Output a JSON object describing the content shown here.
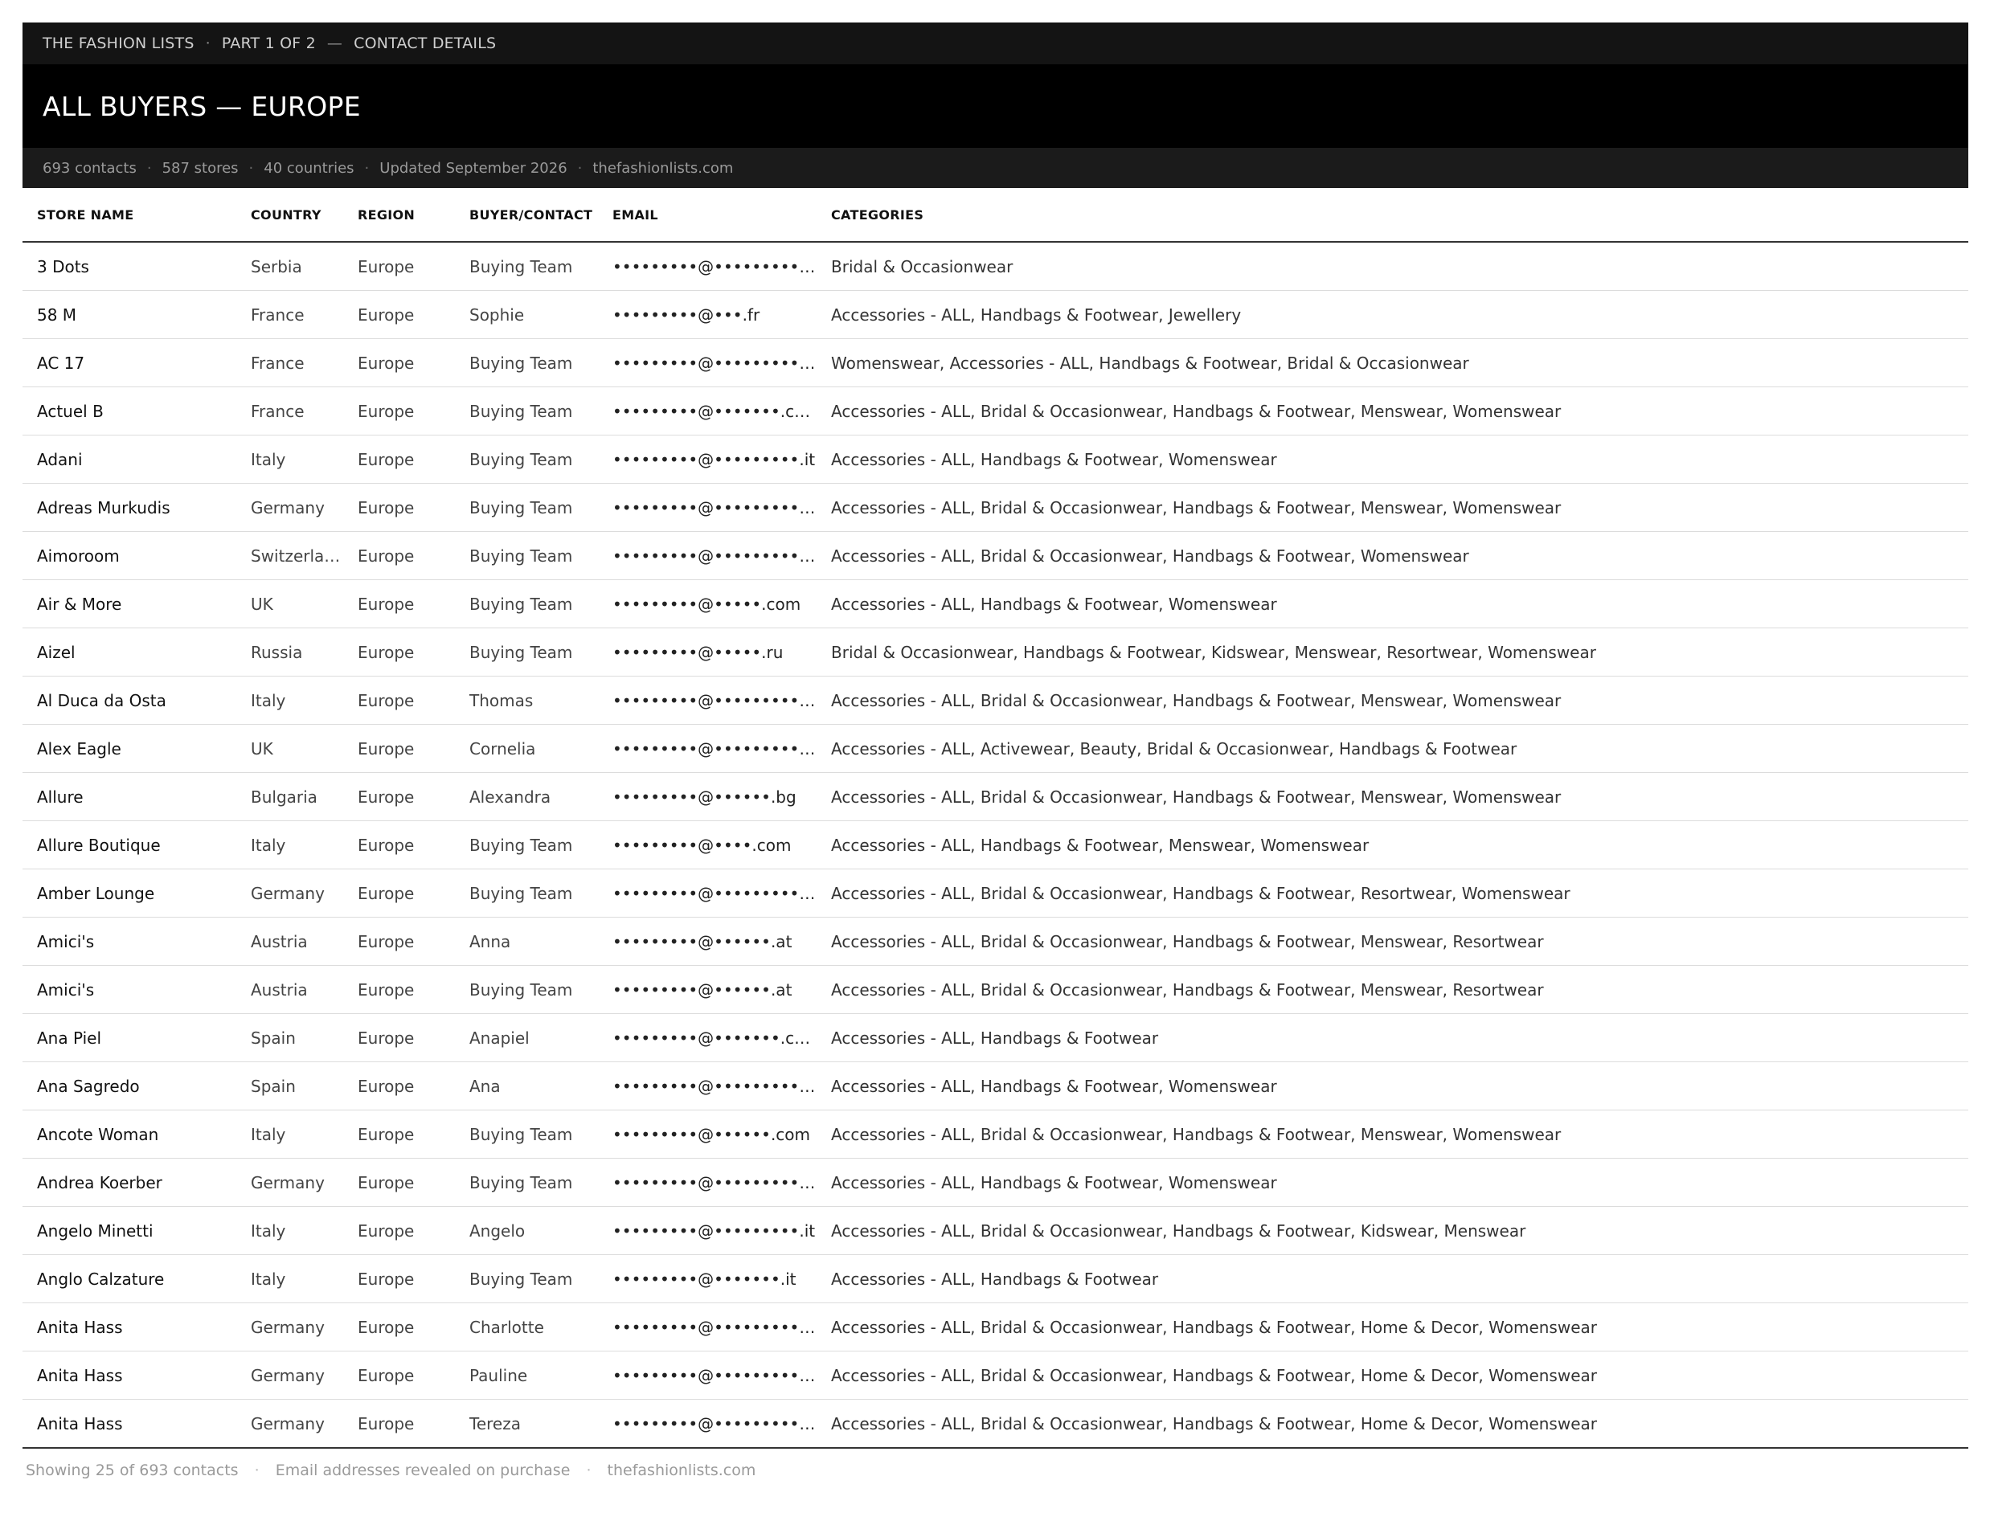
{
  "topbar": {
    "brand": "THE FASHION LISTS",
    "sep": "·",
    "part": "PART 1 OF 2",
    "dash": "—",
    "section": "CONTACT DETAILS"
  },
  "title": "ALL BUYERS — EUROPE",
  "meta": {
    "contacts": "693 contacts",
    "stores": "587 stores",
    "countries": "40 countries",
    "updated": "Updated September 2026",
    "site": "thefashionlists.com",
    "dot": "·"
  },
  "table": {
    "headers": [
      "STORE NAME",
      "COUNTRY",
      "REGION",
      "BUYER/CONTACT",
      "EMAIL",
      "CATEGORIES"
    ],
    "rows": [
      {
        "store": "3 Dots",
        "country": "Serbia",
        "region": "Europe",
        "buyer": "Buying Team",
        "email": "•••••••••@•••••••••.com",
        "categories": "Bridal & Occasionwear"
      },
      {
        "store": "58 M",
        "country": "France",
        "region": "Europe",
        "buyer": "Sophie",
        "email": "•••••••••@•••.fr",
        "categories": "Accessories - ALL, Handbags & Footwear, Jewellery"
      },
      {
        "store": "AC 17",
        "country": "France",
        "region": "Europe",
        "buyer": "Buying Team",
        "email": "•••••••••@•••••••••.com",
        "categories": "Womenswear, Accessories - ALL, Handbags & Footwear, Bridal & Occasionwear"
      },
      {
        "store": "Actuel B",
        "country": "France",
        "region": "Europe",
        "buyer": "Buying Team",
        "email": "•••••••••@•••••••.com",
        "categories": "Accessories - ALL, Bridal & Occasionwear, Handbags & Footwear, Menswear, Womenswear"
      },
      {
        "store": "Adani",
        "country": "Italy",
        "region": "Europe",
        "buyer": "Buying Team",
        "email": "•••••••••@•••••••••.it",
        "categories": "Accessories - ALL, Handbags & Footwear, Womenswear"
      },
      {
        "store": "Adreas Murkudis",
        "country": "Germany",
        "region": "Europe",
        "buyer": "Buying Team",
        "email": "•••••••••@•••••••••.com",
        "categories": "Accessories - ALL, Bridal & Occasionwear, Handbags & Footwear, Menswear, Womenswear"
      },
      {
        "store": "Aimoroom",
        "country": "Switzerland",
        "region": "Europe",
        "buyer": "Buying Team",
        "email": "•••••••••@•••••••••.ch",
        "categories": "Accessories - ALL, Bridal & Occasionwear, Handbags & Footwear, Womenswear"
      },
      {
        "store": "Air & More",
        "country": "UK",
        "region": "Europe",
        "buyer": "Buying Team",
        "email": "•••••••••@•••••.com",
        "categories": "Accessories - ALL, Handbags & Footwear, Womenswear"
      },
      {
        "store": "Aizel",
        "country": "Russia",
        "region": "Europe",
        "buyer": "Buying Team",
        "email": "•••••••••@•••••.ru",
        "categories": "Bridal & Occasionwear, Handbags & Footwear, Kidswear, Menswear, Resortwear, Womenswear"
      },
      {
        "store": "Al Duca da Osta",
        "country": "Italy",
        "region": "Europe",
        "buyer": "Thomas",
        "email": "•••••••••@•••••••••.com",
        "categories": "Accessories - ALL, Bridal & Occasionwear, Handbags & Footwear, Menswear, Womenswear"
      },
      {
        "store": "Alex Eagle",
        "country": "UK",
        "region": "Europe",
        "buyer": "Cornelia",
        "email": "•••••••••@•••••••••.com",
        "categories": "Accessories - ALL, Activewear, Beauty, Bridal & Occasionwear, Handbags & Footwear"
      },
      {
        "store": "Allure",
        "country": "Bulgaria",
        "region": "Europe",
        "buyer": "Alexandra",
        "email": "•••••••••@••••••.bg",
        "categories": "Accessories - ALL, Bridal & Occasionwear, Handbags & Footwear, Menswear, Womenswear"
      },
      {
        "store": "Allure Boutique",
        "country": "Italy",
        "region": "Europe",
        "buyer": "Buying Team",
        "email": "•••••••••@••••.com",
        "categories": "Accessories - ALL, Handbags & Footwear, Menswear, Womenswear"
      },
      {
        "store": "Amber Lounge",
        "country": "Germany",
        "region": "Europe",
        "buyer": "Buying Team",
        "email": "•••••••••@•••••••••.de",
        "categories": "Accessories - ALL, Bridal & Occasionwear, Handbags & Footwear, Resortwear, Womenswear"
      },
      {
        "store": "Amici's",
        "country": "Austria",
        "region": "Europe",
        "buyer": "Anna",
        "email": "•••••••••@••••••.at",
        "categories": "Accessories - ALL, Bridal & Occasionwear, Handbags & Footwear, Menswear, Resortwear"
      },
      {
        "store": "Amici's",
        "country": "Austria",
        "region": "Europe",
        "buyer": "Buying Team",
        "email": "•••••••••@••••••.at",
        "categories": "Accessories - ALL, Bridal & Occasionwear, Handbags & Footwear, Menswear, Resortwear"
      },
      {
        "store": "Ana Piel",
        "country": "Spain",
        "region": "Europe",
        "buyer": "Anapiel",
        "email": "•••••••••@•••••••.com",
        "categories": "Accessories - ALL, Handbags & Footwear"
      },
      {
        "store": "Ana Sagredo",
        "country": "Spain",
        "region": "Europe",
        "buyer": "Ana",
        "email": "•••••••••@•••••••••.com",
        "categories": "Accessories - ALL, Handbags & Footwear, Womenswear"
      },
      {
        "store": "Ancote Woman",
        "country": "Italy",
        "region": "Europe",
        "buyer": "Buying Team",
        "email": "•••••••••@••••••.com",
        "categories": "Accessories - ALL, Bridal & Occasionwear, Handbags & Footwear, Menswear, Womenswear"
      },
      {
        "store": "Andrea Koerber",
        "country": "Germany",
        "region": "Europe",
        "buyer": "Buying Team",
        "email": "•••••••••@•••••••••.de",
        "categories": "Accessories - ALL, Handbags & Footwear, Womenswear"
      },
      {
        "store": "Angelo Minetti",
        "country": "Italy",
        "region": "Europe",
        "buyer": "Angelo",
        "email": "•••••••••@•••••••••.it",
        "categories": "Accessories - ALL, Bridal & Occasionwear, Handbags & Footwear, Kidswear, Menswear"
      },
      {
        "store": "Anglo Calzature",
        "country": "Italy",
        "region": "Europe",
        "buyer": "Buying Team",
        "email": "•••••••••@•••••••.it",
        "categories": "Accessories - ALL, Handbags & Footwear"
      },
      {
        "store": "Anita Hass",
        "country": "Germany",
        "region": "Europe",
        "buyer": "Charlotte",
        "email": "•••••••••@•••••••••.com",
        "categories": "Accessories - ALL, Bridal & Occasionwear, Handbags & Footwear, Home & Decor, Womenswear"
      },
      {
        "store": "Anita Hass",
        "country": "Germany",
        "region": "Europe",
        "buyer": "Pauline",
        "email": "•••••••••@•••••••••.com",
        "categories": "Accessories - ALL, Bridal & Occasionwear, Handbags & Footwear, Home & Decor, Womenswear"
      },
      {
        "store": "Anita Hass",
        "country": "Germany",
        "region": "Europe",
        "buyer": "Tereza",
        "email": "•••••••••@•••••••••.com",
        "categories": "Accessories - ALL, Bridal & Occasionwear, Handbags & Footwear, Home & Decor, Womenswear"
      }
    ]
  },
  "footer": {
    "showing": "Showing 25 of 693 contacts",
    "note": "Email addresses revealed on purchase",
    "site": "thefashionlists.com",
    "dot": "·"
  }
}
